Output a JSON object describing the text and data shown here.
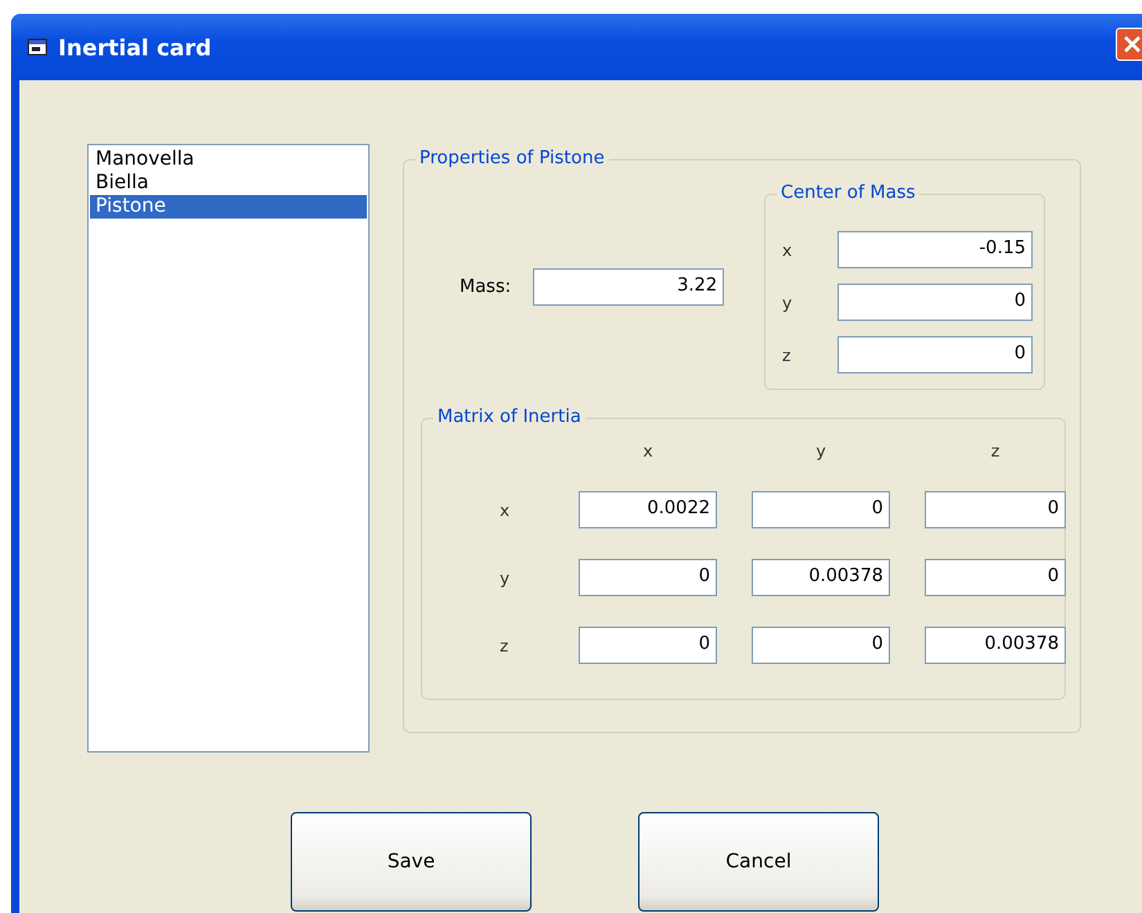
{
  "window": {
    "title": "Inertial card"
  },
  "bodies": [
    {
      "label": "Manovella",
      "selected": false
    },
    {
      "label": "Biella",
      "selected": false
    },
    {
      "label": "Pistone",
      "selected": true
    }
  ],
  "properties": {
    "title": "Properties of Pistone",
    "mass_label": "Mass:",
    "mass": "3.22",
    "center_of_mass": {
      "title": "Center of Mass",
      "rows": [
        {
          "label": "x",
          "value": "-0.15"
        },
        {
          "label": "y",
          "value": "0"
        },
        {
          "label": "z",
          "value": "0"
        }
      ]
    },
    "matrix": {
      "title": "Matrix of Inertia",
      "columns": [
        "x",
        "y",
        "z"
      ],
      "rows": [
        {
          "label": "x",
          "values": [
            "0.0022",
            "0",
            "0"
          ]
        },
        {
          "label": "y",
          "values": [
            "0",
            "0.00378",
            "0"
          ]
        },
        {
          "label": "z",
          "values": [
            "0",
            "0",
            "0.00378"
          ]
        }
      ]
    }
  },
  "buttons": [
    "Save",
    "Cancel"
  ]
}
